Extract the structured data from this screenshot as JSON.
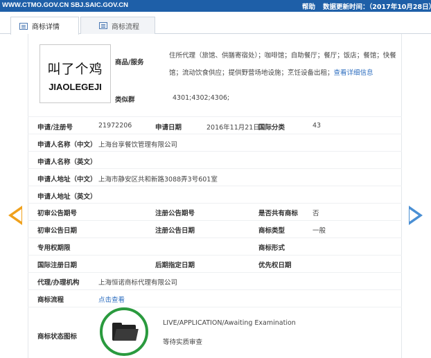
{
  "topbar": {
    "sites": "WWW.CTMO.GOV.CN SBJ.SAIC.GOV.CN",
    "help": "帮助",
    "updated": "数据更新时间：（2017年10月28日）"
  },
  "tabs": [
    {
      "label": "商标详情",
      "icon": "document-icon",
      "active": true
    },
    {
      "label": "商标流程",
      "icon": "list-icon",
      "active": false
    }
  ],
  "mark": {
    "text_cn": "叫了个鸡",
    "text_en": "JIAOLEGEJI"
  },
  "goods": {
    "label": "商品/服务",
    "value": "住所代理（旅馆、供膳寄宿处）；咖啡馆；自助餐厅；餐厅；饭店；餐馆；快餐馆；流动饮食供应；提供野营场地设施；烹饪设备出租；",
    "link": "查看详细信息"
  },
  "similar_group": {
    "label": "类似群",
    "value": "4301;4302;4306;"
  },
  "fields": {
    "reg_no_label": "申请/注册号",
    "reg_no": "21972206",
    "app_date_label": "申请日期",
    "app_date": "2016年11月21日",
    "intl_class_label": "国际分类",
    "intl_class": "43",
    "applicant_cn_label": "申请人名称（中文）",
    "applicant_cn": "上海台享餐饮管理有限公司",
    "applicant_en_label": "申请人名称（英文）",
    "address_cn_label": "申请人地址（中文）",
    "address_cn": "上海市静安区共和新路3088弄3号601室",
    "address_en_label": "申请人地址（英文）",
    "prelim_issue_label": "初审公告期号",
    "reg_issue_label": "注册公告期号",
    "shared_label": "是否共有商标",
    "shared": "否",
    "prelim_date_label": "初审公告日期",
    "reg_date_label": "注册公告日期",
    "type_label": "商标类型",
    "type": "一般",
    "exclusive_label": "专用权期限",
    "form_label": "商标形式",
    "intl_reg_date_label": "国际注册日期",
    "later_date_label": "后期指定日期",
    "priority_date_label": "优先权日期",
    "agent_label": "代理/办理机构",
    "agent": "上海恒诺商标代理有限公司",
    "flow_label": "商标流程",
    "flow_link": "点击查看",
    "status_label": "商标状态图标",
    "status_en": "LIVE/APPLICATION/Awaiting Examination",
    "status_cn": "等待实质审查"
  },
  "colors": {
    "topbar": "#1e5fa8",
    "link": "#2f6fc0",
    "arrow_prev": "#f0a11c",
    "arrow_next": "#4a8fd4",
    "status_ring": "#2a9a3e"
  }
}
